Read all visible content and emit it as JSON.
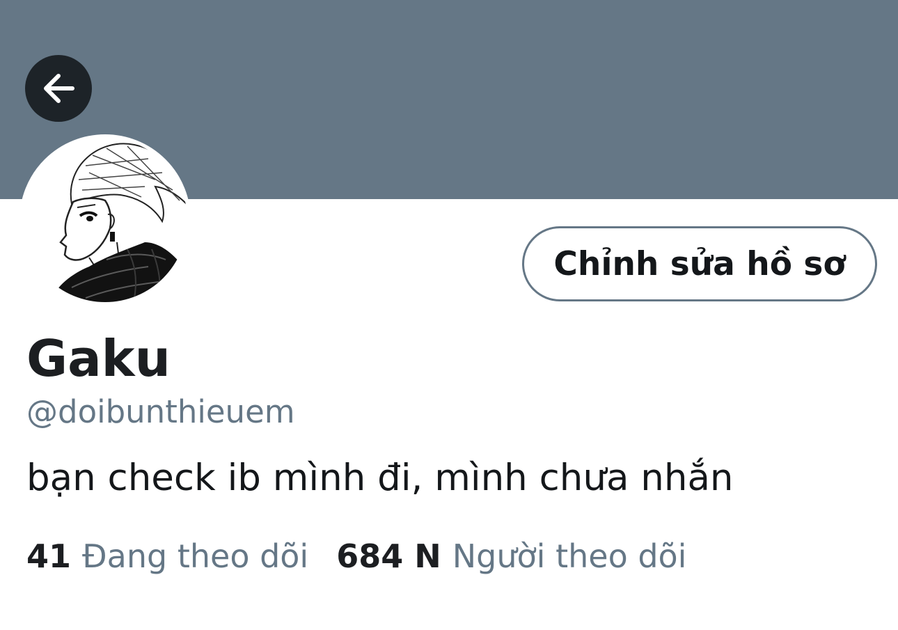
{
  "profile": {
    "display_name": "Gaku",
    "handle": "@doibunthieuem",
    "bio": "bạn check ib mình đi, mình chưa nhắn",
    "edit_profile_label": "Chỉnh sửa hồ sơ"
  },
  "stats": {
    "following_count": "41",
    "following_label": "Đang theo dõi",
    "followers_count": "684 N",
    "followers_label": "Người theo dõi"
  },
  "icons": {
    "back": "back-arrow-icon"
  },
  "colors": {
    "banner": "#657786",
    "back_button": "#1d2328",
    "secondary_text": "#657786",
    "primary_text": "#14171a"
  }
}
